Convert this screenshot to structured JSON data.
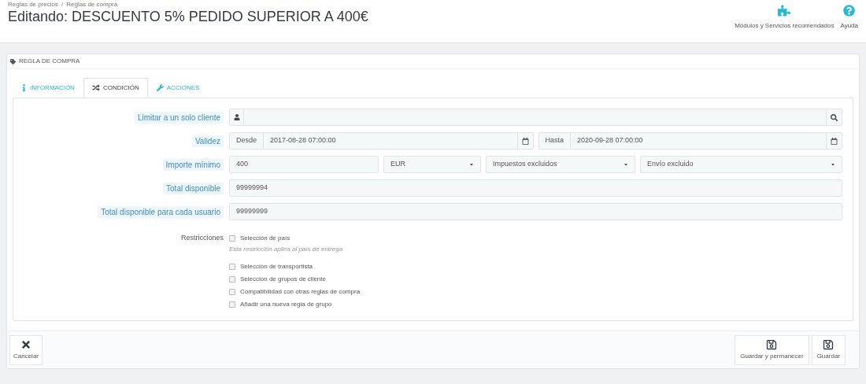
{
  "breadcrumb": [
    "Reglas de precios",
    "Reglas de compra"
  ],
  "breadcrumb_separator": "/",
  "title": "Editando: DESCUENTO 5% PEDIDO SUPERIOR A 400€",
  "toolbar": [
    {
      "kind": "modules",
      "label": "Módulos y Servicios recomendados"
    },
    {
      "kind": "help",
      "label": "Ayuda"
    }
  ],
  "panel": {
    "title": "REGLA DE COMPRA"
  },
  "tabs": [
    {
      "kind": "info",
      "label": "INFORMACIÓN",
      "selected": false
    },
    {
      "kind": "shuffle",
      "label": "CONDICIÓN",
      "selected": true
    },
    {
      "kind": "wrench",
      "label": "ACCIONES",
      "selected": false
    }
  ],
  "fields": [
    {
      "kind": "search",
      "label": "Limitar a un solo cliente"
    },
    {
      "kind": "daterange",
      "label": "Validez",
      "from_label": "Desde",
      "from": "2017-08-28 07:00:00",
      "to_label": "Hasta",
      "to": "2020-09-28 07:00:00"
    },
    {
      "kind": "amount",
      "label": "Importe mínimo",
      "value": "400",
      "selects": [
        "EUR",
        "Impuestos excluidos",
        "Envío excluido"
      ]
    },
    {
      "kind": "text",
      "label": "Total disponible",
      "value": "99999994"
    },
    {
      "kind": "text",
      "label": "Total disponible para cada usuario",
      "value": "99999999"
    }
  ],
  "restrictions": {
    "label": "Restricciones",
    "items": [
      {
        "label": "Selección de país",
        "checked": false,
        "hint": "Esta restricción aplica al país de entrega"
      },
      {
        "label": "Selección de transportista",
        "checked": false
      },
      {
        "label": "Selección de grupos de cliente",
        "checked": false
      },
      {
        "label": "Compatibilidad con otras reglas de compra",
        "checked": false
      },
      {
        "label": "Añadir una nueva regla de grupo",
        "checked": false
      }
    ]
  },
  "footer": {
    "cancel": "Cancelar",
    "save_stay": "Guardar y permanecer",
    "save": "Guardar"
  }
}
